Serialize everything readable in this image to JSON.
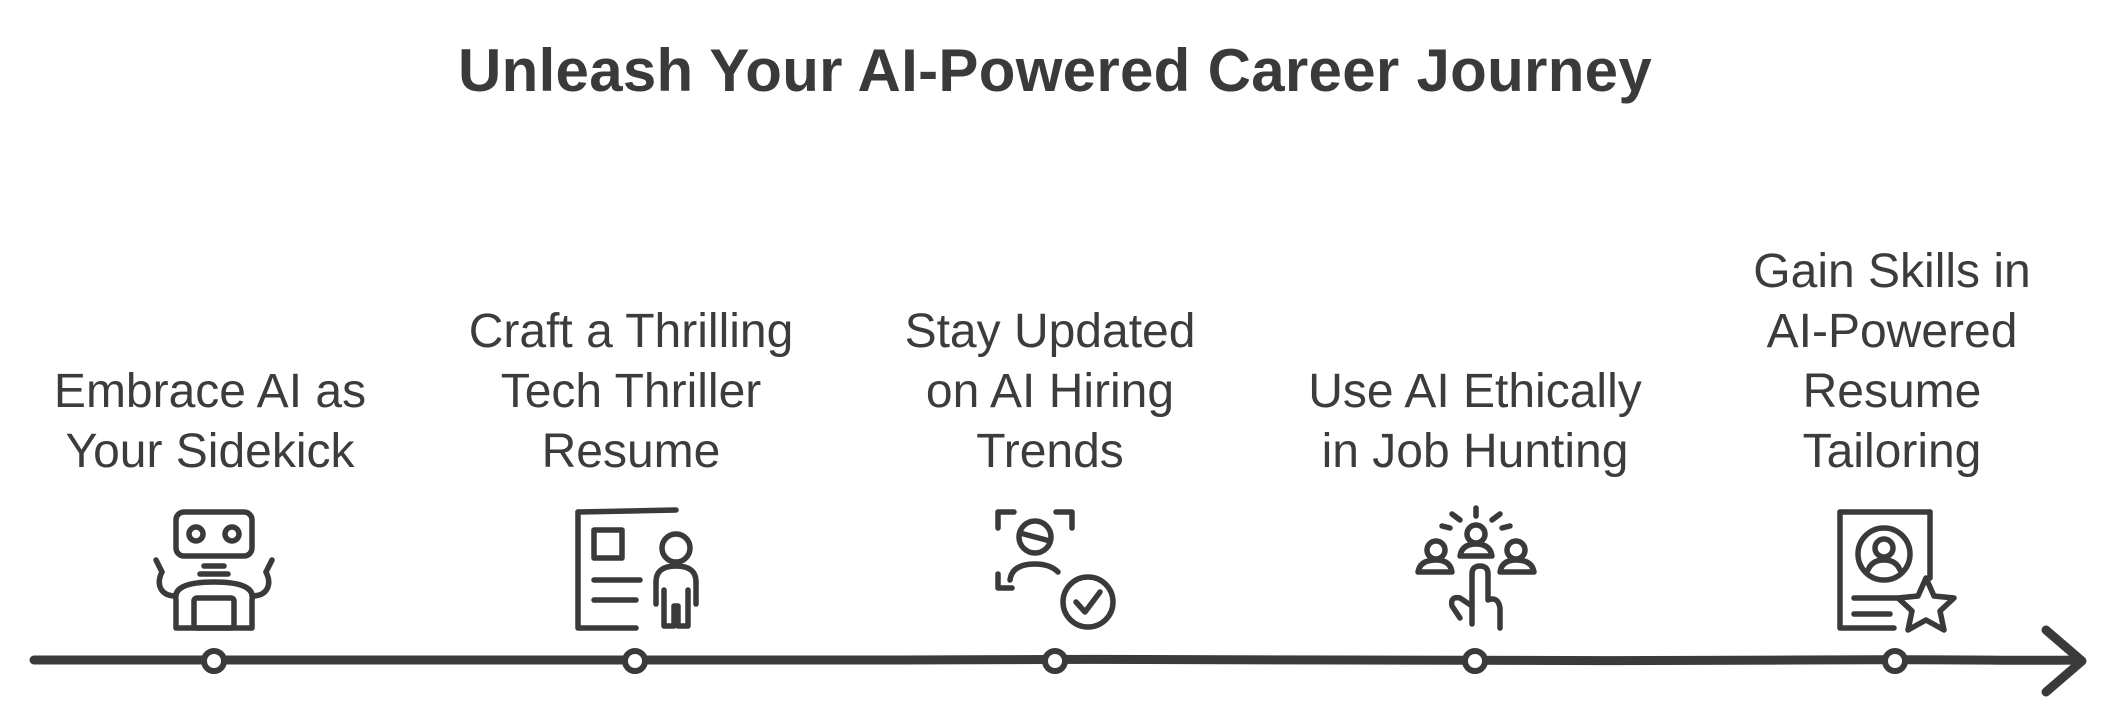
{
  "title": "Unleash Your AI-Powered Career Journey",
  "steps": [
    {
      "label": "Embrace AI as\nYour Sidekick",
      "icon": "robot-icon"
    },
    {
      "label": "Craft a Thrilling\nTech Thriller\nResume",
      "icon": "resume-person-icon"
    },
    {
      "label": "Stay Updated\non AI Hiring\nTrends",
      "icon": "face-scan-check-icon"
    },
    {
      "label": "Use AI Ethically\nin Job Hunting",
      "icon": "people-hand-pointer-icon"
    },
    {
      "label": "Gain Skills in\nAI-Powered\nResume\nTailoring",
      "icon": "profile-document-star-icon"
    }
  ],
  "colors": {
    "line": "#3a3a3a",
    "text": "#3c3c3c",
    "background": "#ffffff"
  }
}
